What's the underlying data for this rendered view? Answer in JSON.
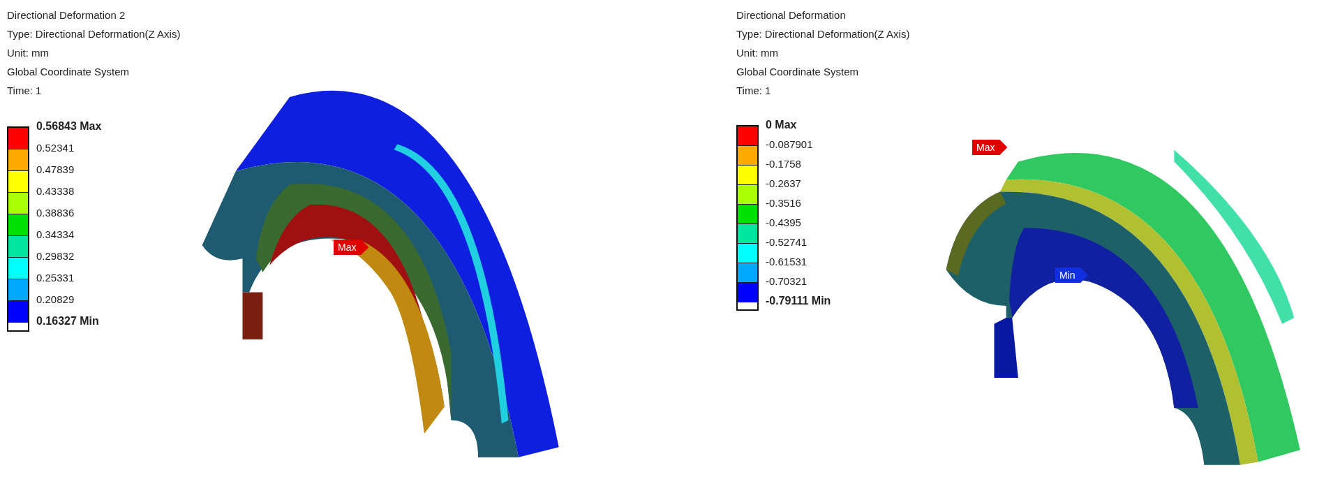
{
  "panels": [
    {
      "info": [
        "Directional Deformation 2",
        "Type: Directional Deformation(Z Axis)",
        "Unit: mm",
        "Global Coordinate System",
        "Time: 1"
      ],
      "legend": {
        "labels": [
          {
            "text": "0.56843 Max",
            "kind": "max"
          },
          {
            "text": "0.52341",
            "kind": "value"
          },
          {
            "text": "0.47839",
            "kind": "value"
          },
          {
            "text": "0.43338",
            "kind": "value"
          },
          {
            "text": "0.38836",
            "kind": "value"
          },
          {
            "text": "0.34334",
            "kind": "value"
          },
          {
            "text": "0.29832",
            "kind": "value"
          },
          {
            "text": "0.25331",
            "kind": "value"
          },
          {
            "text": "0.20829",
            "kind": "value"
          },
          {
            "text": "0.16327 Min",
            "kind": "min"
          }
        ],
        "bands": [
          {
            "color": "#ff0000"
          },
          {
            "color": "#ffaa00"
          },
          {
            "color": "#ffff00"
          },
          {
            "color": "#aaff00"
          },
          {
            "color": "#00e000"
          },
          {
            "color": "#00e6a0"
          },
          {
            "color": "#00ffff"
          },
          {
            "color": "#00a8ff"
          },
          {
            "color": "#0000ff"
          }
        ]
      },
      "probes": [
        {
          "label": "Max",
          "kind": "max"
        }
      ]
    },
    {
      "info": [
        "Directional Deformation",
        "Type: Directional Deformation(Z Axis)",
        "Unit: mm",
        "Global Coordinate System",
        "Time: 1"
      ],
      "legend": {
        "labels": [
          {
            "text": "0 Max",
            "kind": "max"
          },
          {
            "text": "-0.087901",
            "kind": "value"
          },
          {
            "text": "-0.1758",
            "kind": "value"
          },
          {
            "text": "-0.2637",
            "kind": "value"
          },
          {
            "text": "-0.3516",
            "kind": "value"
          },
          {
            "text": "-0.4395",
            "kind": "value"
          },
          {
            "text": "-0.52741",
            "kind": "value"
          },
          {
            "text": "-0.61531",
            "kind": "value"
          },
          {
            "text": "-0.70321",
            "kind": "value"
          },
          {
            "text": "-0.79111 Min",
            "kind": "min"
          }
        ],
        "bands": [
          {
            "color": "#ff0000"
          },
          {
            "color": "#ffaa00"
          },
          {
            "color": "#ffff00"
          },
          {
            "color": "#aaff00"
          },
          {
            "color": "#00e000"
          },
          {
            "color": "#00e6a0"
          },
          {
            "color": "#00ffff"
          },
          {
            "color": "#00a8ff"
          },
          {
            "color": "#0000ff"
          }
        ]
      },
      "probes": [
        {
          "label": "Max",
          "kind": "max"
        },
        {
          "label": "Min",
          "kind": "min"
        }
      ]
    }
  ]
}
